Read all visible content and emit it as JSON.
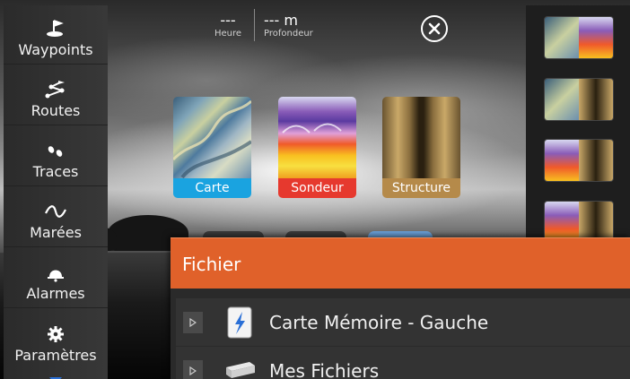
{
  "sidebar": {
    "items": [
      {
        "label": "Waypoints",
        "icon": "waypoint-flag-icon"
      },
      {
        "label": "Routes",
        "icon": "route-icon"
      },
      {
        "label": "Traces",
        "icon": "trail-icon"
      },
      {
        "label": "Marées",
        "icon": "tide-wave-icon"
      },
      {
        "label": "Alarmes",
        "icon": "alarm-bell-icon"
      },
      {
        "label": "Paramètres",
        "icon": "gear-icon"
      }
    ]
  },
  "readouts": {
    "time": {
      "value": "---",
      "label": "Heure"
    },
    "depth": {
      "value": "--- m",
      "label": "Profondeur"
    }
  },
  "apps": [
    {
      "label": "Carte",
      "color": "#1aa3e0"
    },
    {
      "label": "Sondeur",
      "color": "#e6392e"
    },
    {
      "label": "Structure",
      "color": "#b58a4a"
    }
  ],
  "file_panel": {
    "title": "Fichier",
    "items": [
      {
        "name": "Carte Mémoire - Gauche",
        "icon": "memory-card-icon"
      },
      {
        "name": "Mes Fichiers",
        "icon": "drive-icon"
      }
    ]
  },
  "colors": {
    "accent": "#e0612a",
    "carte": "#1aa3e0",
    "sondeur": "#e6392e",
    "structure": "#b58a4a"
  }
}
